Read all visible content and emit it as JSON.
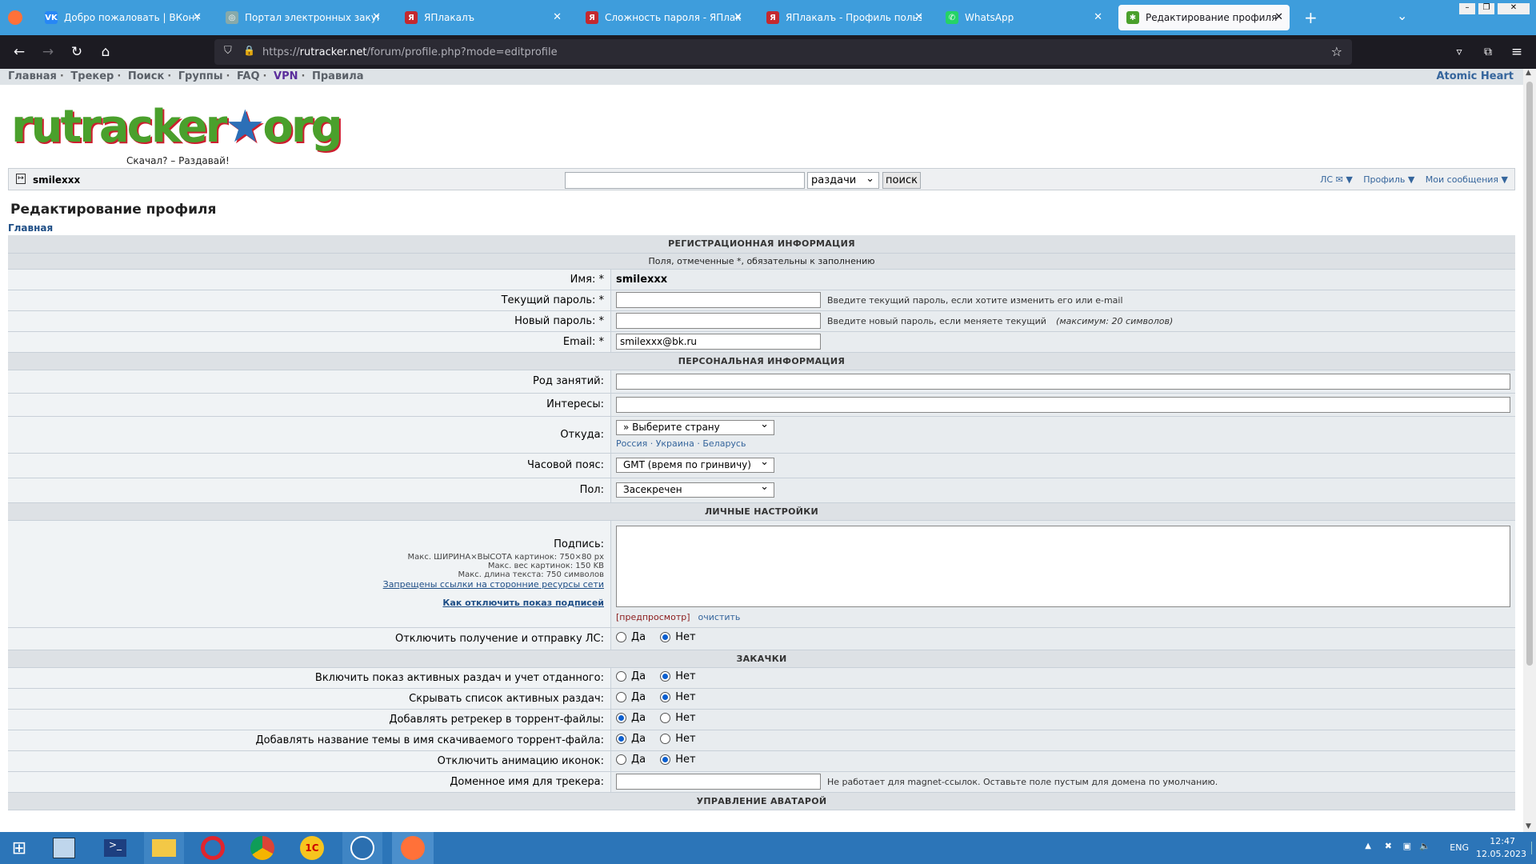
{
  "tabs": [
    {
      "label": "Добро пожаловать | ВКонтакт",
      "icon": "vk-icon",
      "color": "#2787f5",
      "letter": "VK"
    },
    {
      "label": "Портал электронных закупок",
      "icon": "globe-icon",
      "color": "#8aa",
      "letter": "◎"
    },
    {
      "label": "ЯПлакалъ",
      "icon": "yaplakal-icon",
      "color": "#c4292f",
      "letter": "Я"
    },
    {
      "label": "Сложность пароля - ЯПлакалъ",
      "icon": "yaplakal-icon",
      "color": "#c4292f",
      "letter": "Я"
    },
    {
      "label": "ЯПлакалъ - Профиль пользов",
      "icon": "yaplakal-icon",
      "color": "#c4292f",
      "letter": "Я"
    },
    {
      "label": "WhatsApp",
      "icon": "whatsapp-icon",
      "color": "#25d366",
      "letter": "✆"
    },
    {
      "label": "Редактирование профиля",
      "icon": "rutracker-icon",
      "color": "#4aa02c",
      "letter": "✱"
    }
  ],
  "url": {
    "prefix": "https://",
    "domain": "rutracker.net",
    "path": "/forum/profile.php?mode=editprofile"
  },
  "topmenu": {
    "items": [
      "Главная",
      "Трекер",
      "Поиск",
      "Группы",
      "FAQ",
      "VPN",
      "Правила"
    ],
    "right": "Atomic Heart"
  },
  "logo": {
    "text_a": "rutracker",
    "text_b": "org",
    "slogan": "Скачал? – Раздавай!"
  },
  "userbar": {
    "username": "smilexxx",
    "search_scope": "раздачи",
    "search_button": "поиск",
    "links": [
      "ЛС ✉ ▼",
      "Профиль ▼",
      "Мои сообщения ▼"
    ]
  },
  "page": {
    "title": "Редактирование профиля",
    "breadcrumb": "Главная"
  },
  "sections": {
    "reg": "РЕГИСТРАЦИОННАЯ ИНФОРМАЦИЯ",
    "reg_note": "Поля, отмеченные *, обязательны к заполнению",
    "personal": "ПЕРСОНАЛЬНАЯ ИНФОРМАЦИЯ",
    "settings": "ЛИЧНЫЕ НАСТРОЙКИ",
    "downloads": "ЗАКАЧКИ",
    "avatar": "УПРАВЛЕНИЕ АВАТАРОЙ"
  },
  "fields": {
    "name_label": "Имя: *",
    "name_value": "smilexxx",
    "cur_pw_label": "Текущий пароль: *",
    "cur_pw_hint": "Введите текущий пароль, если хотите изменить его или e-mail",
    "new_pw_label": "Новый пароль: *",
    "new_pw_hint": "Введите новый пароль, если меняете текущий",
    "new_pw_hint2": "(максимум: 20 символов)",
    "email_label": "Email: *",
    "email_value": "smilexxx@bk.ru",
    "occupation_label": "Род занятий:",
    "interests_label": "Интересы:",
    "from_label": "Откуда:",
    "from_value": "» Выберите страну",
    "from_quick": "Россия · Украина · Беларусь",
    "tz_label": "Часовой пояс:",
    "tz_value": "GMT (время по гринвичу)",
    "gender_label": "Пол:",
    "gender_value": "Засекречен",
    "sig_label": "Подпись:",
    "sig_note1": "Макс. ШИРИНА×ВЫСОТА картинок: 750×80 px",
    "sig_note2": "Макс. вес картинок: 150 KB",
    "sig_note3": "Макс. длина текста: 750 символов",
    "sig_link1": "Запрещены ссылки на сторонние ресурсы сети",
    "sig_link2": "Как отключить показ подписей",
    "sig_preview": "[предпросмотр]",
    "sig_clear": "очистить",
    "pm_label": "Отключить получение и отправку ЛС:",
    "dl1_label": "Включить показ активных раздач и учет отданного:",
    "dl2_label": "Скрывать список активных раздач:",
    "dl3_label": "Добавлять ретрекер в торрент-файлы:",
    "dl4_label": "Добавлять название темы в имя скачиваемого торрент-файла:",
    "dl5_label": "Отключить анимацию иконок:",
    "domain_label": "Доменное имя для трекера:",
    "domain_hint": "Не работает для magnet-ссылок. Оставьте поле пустым для домена по умолчанию."
  },
  "radio": {
    "yes": "Да",
    "no": "Нет"
  },
  "tray": {
    "lang": "ENG",
    "time": "12:47",
    "date": "12.05.2023"
  }
}
